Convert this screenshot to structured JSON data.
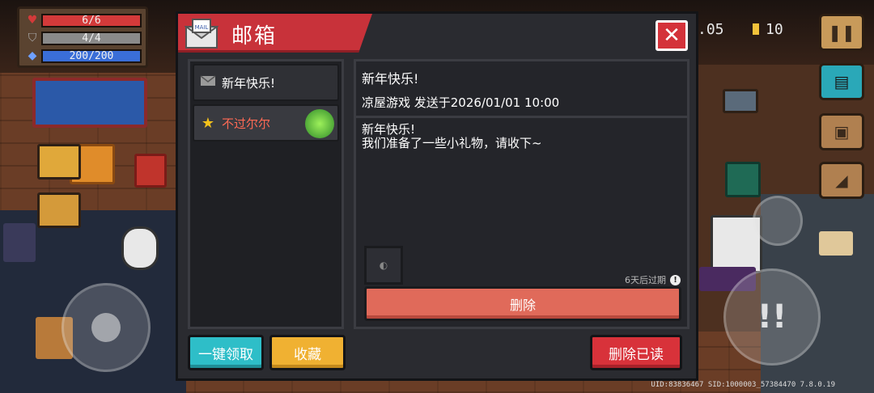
{
  "stats": {
    "health": {
      "current": 6,
      "max": 6,
      "text": "6/6",
      "color": "#d33a3a"
    },
    "armor": {
      "current": 4,
      "max": 4,
      "text": "4/4",
      "color": "#8a8a8a"
    },
    "energy": {
      "current": 200,
      "max": 200,
      "text": "200/200",
      "color": "#3a6ed8"
    }
  },
  "hud": {
    "gems_text": ".05",
    "coins_text": "10",
    "version_text": "UID:83836467 SID:1000003_57384470 7.8.0.19"
  },
  "mailbox": {
    "title": "邮箱",
    "mail_icon_text": "MAIL",
    "close_symbol": "✕",
    "items": [
      {
        "label": "新年快乐!",
        "icon": "envelope-icon",
        "color": "#ffffff"
      },
      {
        "label": "不过尔尔",
        "icon": "star-icon",
        "color": "#ff6a55"
      }
    ],
    "detail": {
      "title": "新年快乐!",
      "sender_line": "凉屋游戏 发送于2026/01/01 10:00",
      "body_line1": "新年快乐!",
      "body_line2": "我们准备了一些小礼物，请收下~",
      "expire_text": "6天后过期",
      "expire_info": "!",
      "delete_label": "删除"
    },
    "buttons": {
      "claim_all": "一键领取",
      "favorite": "收藏",
      "delete_read": "删除已读"
    }
  },
  "colors": {
    "banner_red": "#c8323a",
    "claim_cyan": "#2ebec8",
    "favorite_orange": "#f0b132",
    "delete_salmon": "#e06a5a"
  }
}
